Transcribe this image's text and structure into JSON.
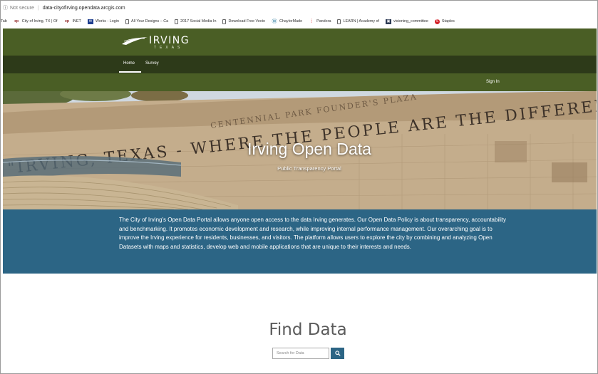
{
  "browser": {
    "security_label": "Not secure",
    "separator": "|",
    "url": "data-cityofirving.opendata.arcgis.com"
  },
  "bookmarks": [
    {
      "label": "Tab",
      "icon": "none"
    },
    {
      "label": "City of Irving, TX | Of",
      "icon": "ep-icon"
    },
    {
      "label": "INET",
      "icon": "ep-icon"
    },
    {
      "label": "Works - Login",
      "icon": "works-icon"
    },
    {
      "label": "All Your Designs – Ca",
      "icon": "page-icon"
    },
    {
      "label": "2017 Social Media In",
      "icon": "page-icon"
    },
    {
      "label": "Download Free Vecto",
      "icon": "page-icon"
    },
    {
      "label": "ChaylorMade",
      "icon": "wordpress-icon"
    },
    {
      "label": "Pandora",
      "icon": "pandora-icon"
    },
    {
      "label": "LEARN | Academy of",
      "icon": "page-icon"
    },
    {
      "label": "visioning_committee",
      "icon": "committee-icon"
    },
    {
      "label": "Staples",
      "icon": "staples-icon"
    }
  ],
  "header": {
    "logo_text": "IRVING",
    "logo_subtext": "TEXAS"
  },
  "nav": {
    "items": [
      {
        "label": "Home",
        "active": true
      },
      {
        "label": "Survey",
        "active": false
      }
    ],
    "sign_in": "Sign In"
  },
  "hero": {
    "wall_inscription": "\"IRVING, TEXAS - WHERE THE PEOPLE ARE THE DIFFERENC",
    "plaza_inscription": "CENTENNIAL PARK FOUNDER'S PLAZA",
    "title": "Irving Open Data",
    "subtitle": "Public Transparency Portal"
  },
  "description": "The City of Irving's Open Data Portal allows anyone open access to the data Irving generates. Our Open Data Policy is about transparency, accountability and benchmarking. It promotes economic development and research, while improving internal performance management. Our overarching goal is to improve the Irving experience for residents, businesses, and visitors. The platform allows users to explore the city by combining and analyzing Open Datasets with maps and statistics, develop web and mobile applications that are unique to their interests and needs.",
  "find_data": {
    "title": "Find Data",
    "search_placeholder": "Search for Data",
    "search_icon": "search-icon"
  },
  "colors": {
    "header_green": "#4a5e25",
    "nav_dark_green": "#2d3a19",
    "band_blue": "#2c6585"
  }
}
